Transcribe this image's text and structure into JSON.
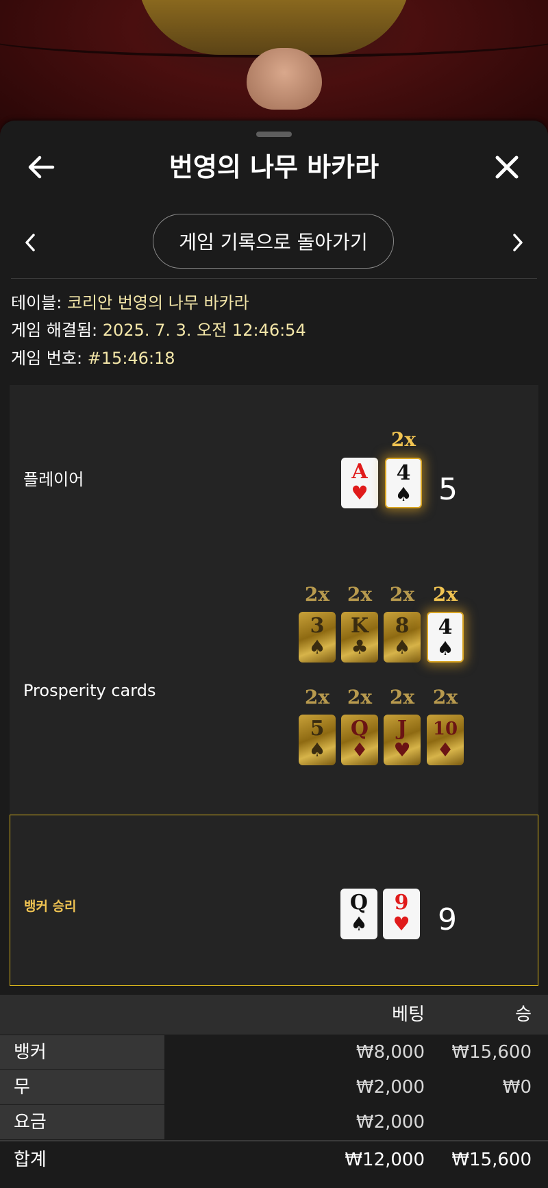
{
  "header": {
    "title": "번영의 나무 바카라"
  },
  "nav": {
    "back_to_history": "게임 기록으로 돌아가기"
  },
  "info": {
    "table_label": "테이블: ",
    "table_value": "코리안 번영의 나무 바카라",
    "resolved_label": "게임 해결됨: ",
    "resolved_value": "2025. 7. 3. 오전 12:46:54",
    "game_no_label": "게임 번호: ",
    "game_no_value": "#15:46:18"
  },
  "player": {
    "label": "플레이어",
    "score": "5",
    "cards": [
      {
        "rank": "A",
        "suit": "♥",
        "color": "red"
      },
      {
        "rank": "4",
        "suit": "♠",
        "color": "black",
        "multiplier": "2x"
      }
    ]
  },
  "prosperity": {
    "label": "Prosperity cards",
    "row1": [
      {
        "rank": "3",
        "suit": "♠",
        "color": "black",
        "multiplier": "2x"
      },
      {
        "rank": "K",
        "suit": "♣",
        "color": "black",
        "multiplier": "2x"
      },
      {
        "rank": "8",
        "suit": "♠",
        "color": "black",
        "multiplier": "2x"
      },
      {
        "rank": "4",
        "suit": "♠",
        "color": "black",
        "multiplier": "2x"
      }
    ],
    "row2": [
      {
        "rank": "5",
        "suit": "♠",
        "color": "black",
        "multiplier": "2x"
      },
      {
        "rank": "Q",
        "suit": "♦",
        "color": "red",
        "multiplier": "2x"
      },
      {
        "rank": "J",
        "suit": "♥",
        "color": "red",
        "multiplier": "2x"
      },
      {
        "rank": "10",
        "suit": "♦",
        "color": "red",
        "multiplier": "2x"
      }
    ]
  },
  "banker": {
    "label": "뱅커 승리",
    "score": "9",
    "cards": [
      {
        "rank": "Q",
        "suit": "♠",
        "color": "black"
      },
      {
        "rank": "9",
        "suit": "♥",
        "color": "red"
      }
    ]
  },
  "bets": {
    "headers": {
      "bet": "베팅",
      "win": "승"
    },
    "rows": [
      {
        "name": "뱅커",
        "bet": "₩8,000",
        "win": "₩15,600"
      },
      {
        "name": "무",
        "bet": "₩2,000",
        "win": "₩0"
      },
      {
        "name": "요금",
        "bet": "₩2,000",
        "win": ""
      }
    ],
    "total": {
      "name": "합계",
      "bet": "₩12,000",
      "win": "₩15,600"
    }
  },
  "colors": {
    "gold": "#f1c452",
    "info_value": "#f3e6a8",
    "banker_border": "#d8b41c"
  }
}
